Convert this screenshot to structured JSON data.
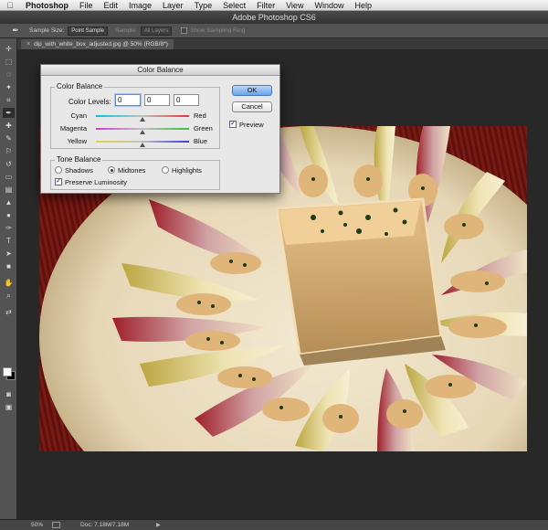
{
  "menubar": {
    "app_name": "Photoshop",
    "items": [
      "File",
      "Edit",
      "Image",
      "Layer",
      "Type",
      "Select",
      "Filter",
      "View",
      "Window",
      "Help"
    ]
  },
  "window": {
    "title": "Adobe Photoshop CS6"
  },
  "options_bar": {
    "sample_size_label": "Sample Size:",
    "sample_size_value": "Point Sample",
    "sample_label": "Sample:",
    "sample_value": "All Layers",
    "sampling_ring_label": "Show Sampling Ring"
  },
  "document_tab": {
    "title": "dip_with_white_box_adjusted.jpg @ 50% (RGB/8*)",
    "close": "×"
  },
  "status_bar": {
    "zoom": "50%",
    "doc_size": "Doc: 7.18M/7.18M",
    "arrow": "▶"
  },
  "dialog": {
    "title": "Color Balance",
    "color_balance_group": "Color Balance",
    "color_levels_label": "Color Levels:",
    "levels": [
      "0",
      "0",
      "0"
    ],
    "sliders": [
      {
        "left": "Cyan",
        "right": "Red",
        "value": 0
      },
      {
        "left": "Magenta",
        "right": "Green",
        "value": 0
      },
      {
        "left": "Yellow",
        "right": "Blue",
        "value": 0
      }
    ],
    "tone_balance_group": "Tone Balance",
    "tones": {
      "shadows": "Shadows",
      "midtones": "Midtones",
      "highlights": "Highlights"
    },
    "selected_tone": "Midtones",
    "preserve_luminosity": "Preserve Luminosity",
    "preserve_checked": true,
    "ok_label": "OK",
    "cancel_label": "Cancel",
    "preview_label": "Preview",
    "preview_checked": true
  },
  "colors": {
    "canvas_bg": "#282828",
    "panel": "#535353",
    "dialog_bg": "#e8e8e8",
    "ok_button": "#6aa3e8"
  }
}
